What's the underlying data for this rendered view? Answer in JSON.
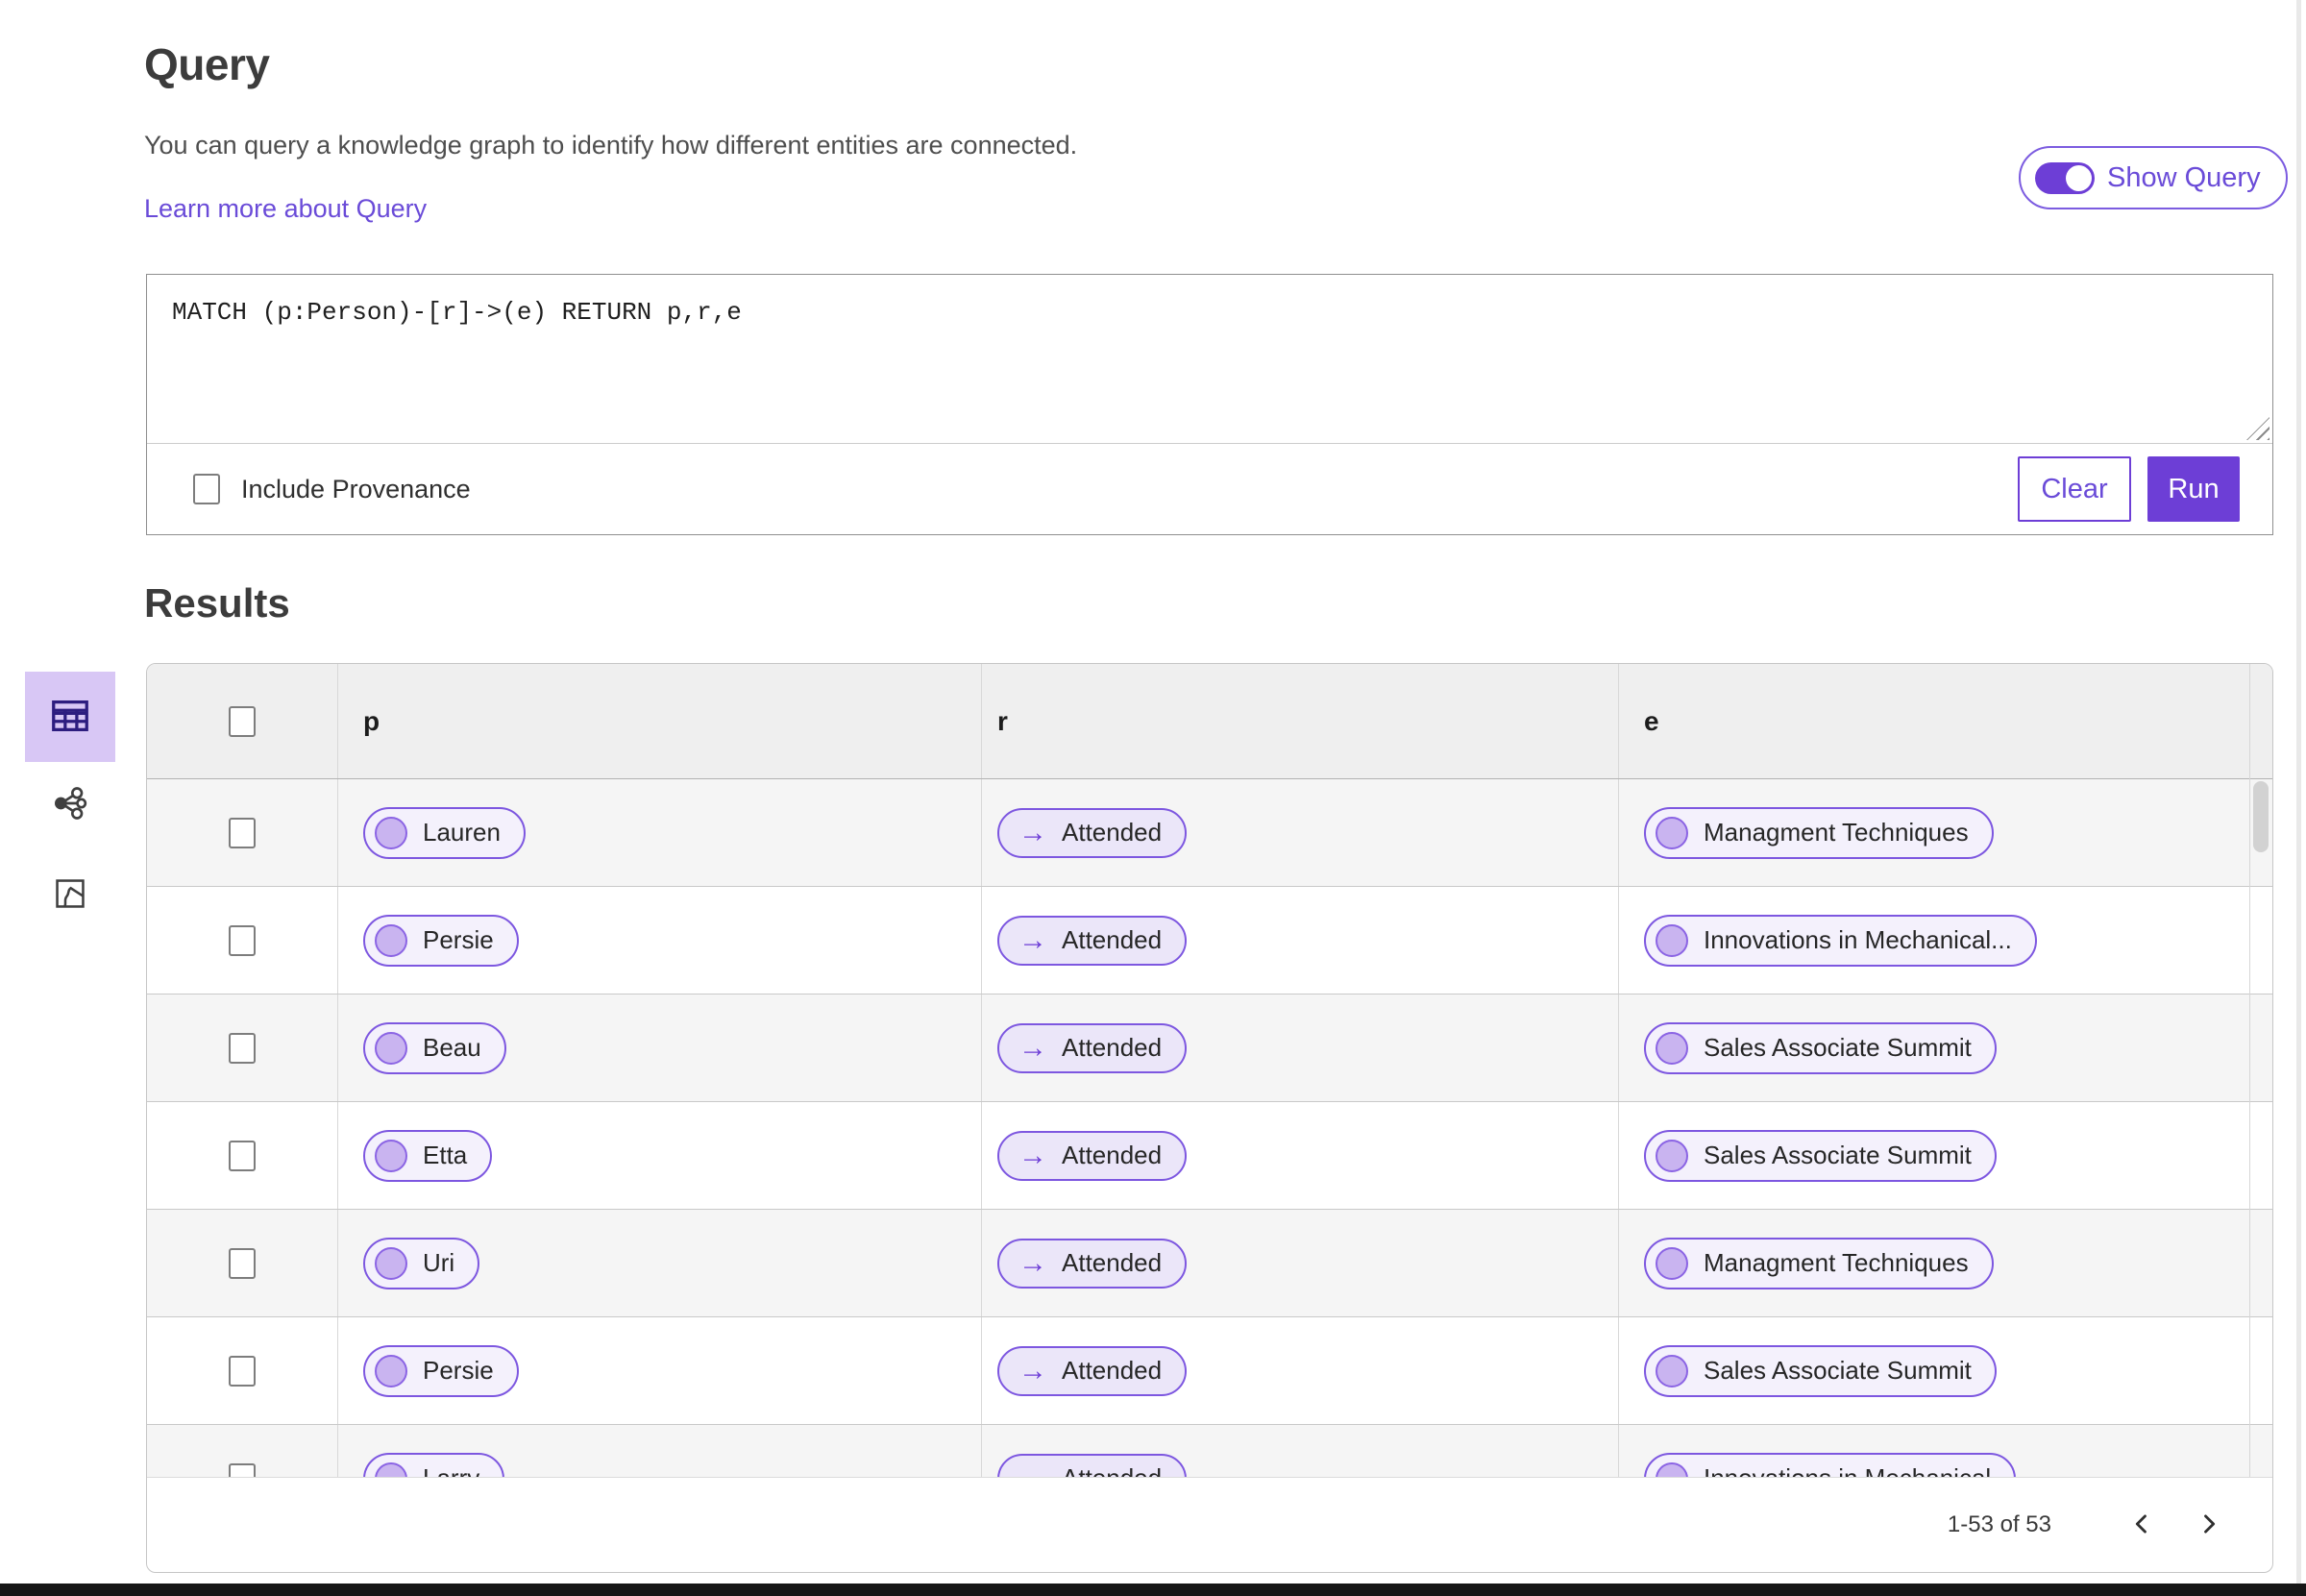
{
  "query_section": {
    "title": "Query",
    "description": "You can query a knowledge graph to identify how different entities are connected.",
    "learn_more": "Learn more about Query",
    "show_query_label": "Show Query",
    "show_query_toggle_on": true,
    "query_text": "MATCH (p:Person)-[r]->(e) RETURN p,r,e",
    "include_provenance_label": "Include Provenance",
    "include_provenance_checked": false,
    "clear_label": "Clear",
    "run_label": "Run"
  },
  "results_section": {
    "title": "Results",
    "view_switcher": {
      "selected": "table-view",
      "options": [
        "table-view",
        "graph-view",
        "map-view"
      ]
    },
    "table": {
      "columns": [
        "p",
        "r",
        "e"
      ],
      "rows": [
        {
          "p": "Lauren",
          "r": "Attended",
          "e": "Managment Techniques"
        },
        {
          "p": "Persie",
          "r": "Attended",
          "e": "Innovations in Mechanical..."
        },
        {
          "p": "Beau",
          "r": "Attended",
          "e": "Sales Associate Summit"
        },
        {
          "p": "Etta",
          "r": "Attended",
          "e": "Sales Associate Summit"
        },
        {
          "p": "Uri",
          "r": "Attended",
          "e": "Managment Techniques"
        },
        {
          "p": "Persie",
          "r": "Attended",
          "e": "Sales Associate Summit"
        },
        {
          "p": "Larry",
          "r": "Attended",
          "e": "Innovations in Mechanical"
        }
      ]
    },
    "pagination": {
      "range_text": "1-53 of 53"
    }
  },
  "icons": {
    "arrow_right": "→",
    "view_switcher": [
      "table-view-icon",
      "graph-view-icon",
      "map-view-icon"
    ],
    "pagination": [
      "chevron-left-icon",
      "chevron-right-icon"
    ],
    "textarea": "resize-handle-icon"
  },
  "colors": {
    "accent_purple": "#6d3ed6",
    "link_purple": "#6a4bd8",
    "pill_border": "#7d57e0",
    "pill_entity_bg": "#f4f1fc",
    "pill_relation_bg": "#ebe6f9",
    "node_circle_fill": "#c9b4f0",
    "selected_view_bg": "#d8c7f5",
    "table_header_bg": "#efefef",
    "row_alt_bg": "#f5f5f5",
    "bottom_strip": "#161616"
  }
}
